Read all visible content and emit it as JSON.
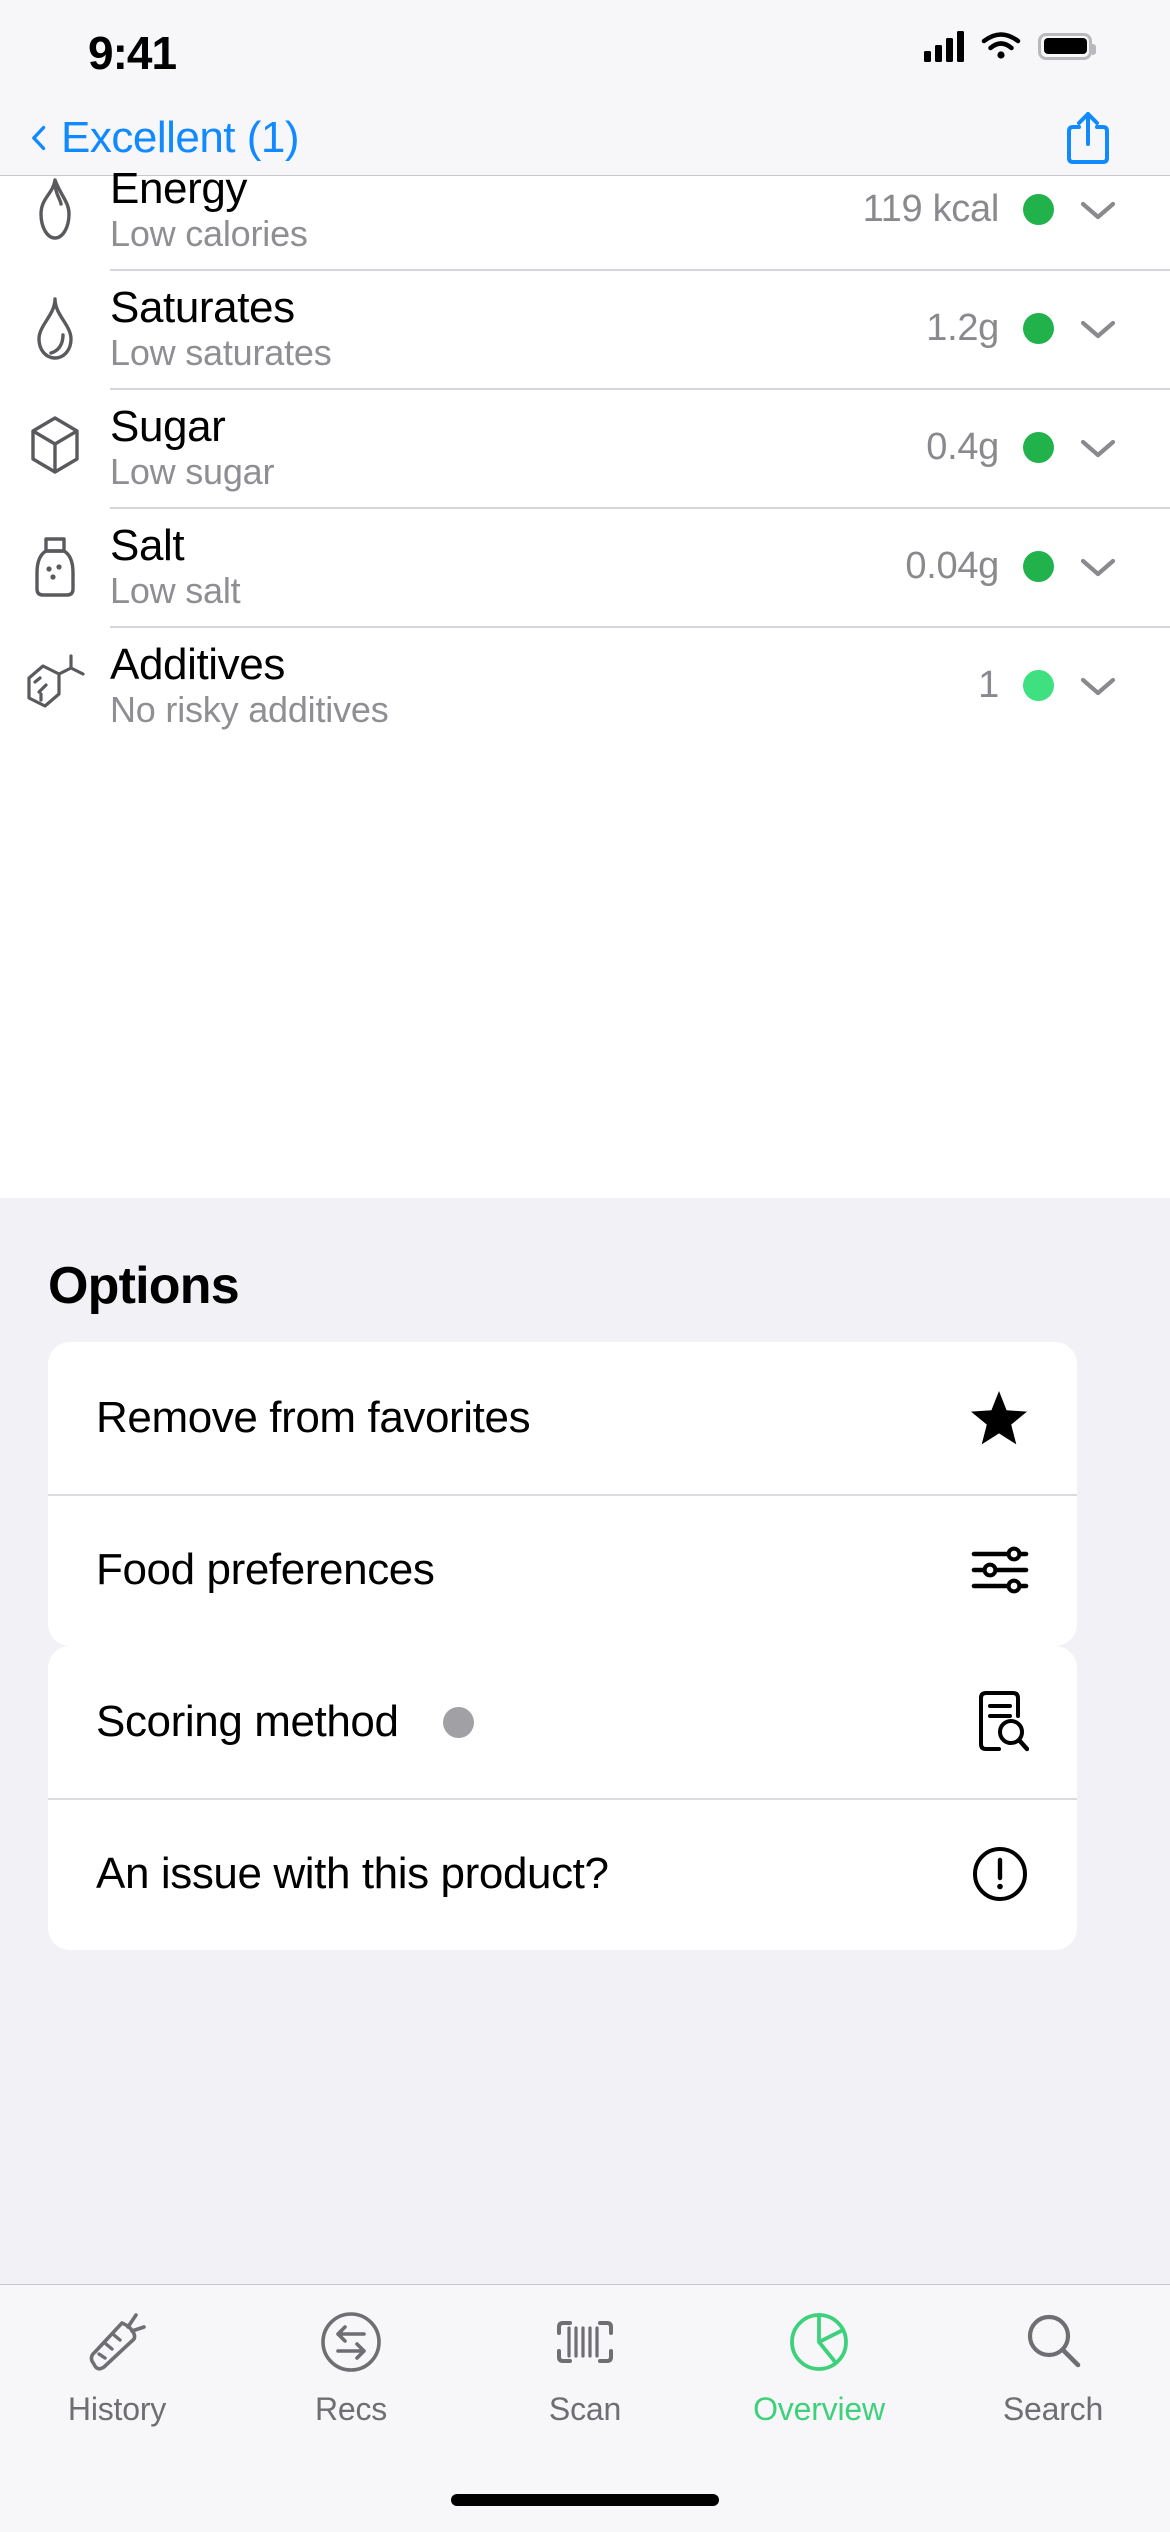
{
  "status_bar": {
    "time": "9:41",
    "cellular_icon": "signal-bars-icon",
    "wifi_icon": "wifi-icon",
    "battery_icon": "battery-icon"
  },
  "nav_bar": {
    "back_label": "Excellent (1)",
    "back_icon": "chevron-left-icon",
    "share_icon": "share-icon"
  },
  "colors": {
    "accent_blue": "#1189ff",
    "green_good": "#22b24c",
    "green_light": "#3ee07f",
    "green_tab_active": "#3ed17c",
    "gray_dot": "#a0a0a5",
    "page_bg": "#f1f1f6",
    "card_bg": "#ffffff",
    "subtext": "#8e8e93"
  },
  "nutrition": {
    "rows": [
      {
        "icon": "flame-icon",
        "title": "Energy",
        "subtitle": "Low calories",
        "value": "119 kcal",
        "dot_color": "#22b24c",
        "chevron": "chevron-down-icon"
      },
      {
        "icon": "droplet-icon",
        "title": "Saturates",
        "subtitle": "Low saturates",
        "value": "1.2g",
        "dot_color": "#22b24c",
        "chevron": "chevron-down-icon"
      },
      {
        "icon": "sugar-cube-icon",
        "title": "Sugar",
        "subtitle": "Low sugar",
        "value": "0.4g",
        "dot_color": "#22b24c",
        "chevron": "chevron-down-icon"
      },
      {
        "icon": "salt-shaker-icon",
        "title": "Salt",
        "subtitle": "Low salt",
        "value": "0.04g",
        "dot_color": "#22b24c",
        "chevron": "chevron-down-icon"
      },
      {
        "icon": "molecule-icon",
        "title": "Additives",
        "subtitle": "No risky additives",
        "value": "1",
        "dot_color": "#3ee07f",
        "chevron": "chevron-down-icon"
      }
    ]
  },
  "options": {
    "heading": "Options",
    "card_a": [
      {
        "label": "Remove from favorites",
        "icon": "star-filled-icon",
        "has_dot": false
      },
      {
        "label": "Food preferences",
        "icon": "sliders-icon",
        "has_dot": false
      }
    ],
    "card_b": [
      {
        "label": "Scoring method",
        "icon": "document-search-icon",
        "has_dot": true,
        "dot_color": "#a0a0a5"
      },
      {
        "label": "An issue with this product?",
        "icon": "exclamation-circle-icon",
        "has_dot": false
      }
    ]
  },
  "tab_bar": {
    "items": [
      {
        "label": "History",
        "icon": "carrot-icon",
        "active": false
      },
      {
        "label": "Recs",
        "icon": "swap-circle-icon",
        "active": false
      },
      {
        "label": "Scan",
        "icon": "barcode-scan-icon",
        "active": false
      },
      {
        "label": "Overview",
        "icon": "pie-chart-icon",
        "active": true
      },
      {
        "label": "Search",
        "icon": "magnifier-icon",
        "active": false
      }
    ]
  }
}
